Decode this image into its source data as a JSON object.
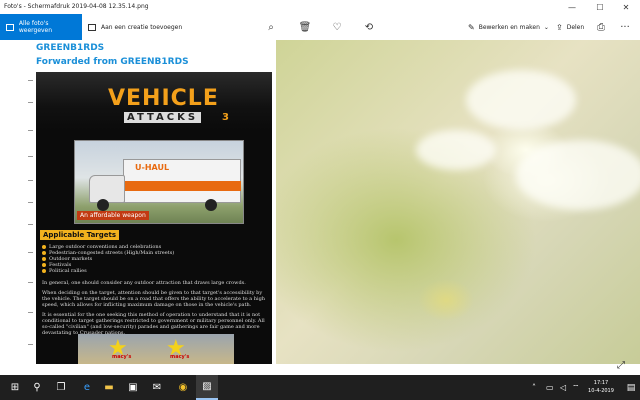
{
  "window": {
    "title": "Foto's - Schermafdruk 2019-04-08 12.35.14.png",
    "minimize": "—",
    "maximize": "☐",
    "close": "✕"
  },
  "toolbar": {
    "all_photos_label": "Alle foto's weergeven",
    "add_creation_label": "Aan een creatie toevoegen",
    "zoom_icon": "⌕",
    "delete_icon": "🗑",
    "favorite_icon": "♡",
    "rotate_icon": "⟲",
    "edit_create_label": "Bewerken en maken",
    "share_label": "Delen",
    "print_icon": "⎙",
    "more_icon": "···"
  },
  "document": {
    "heading_1": "GREENB1RDS",
    "heading_2": "Forwarded from GREENB1RDS",
    "magazine": {
      "title_main": "VEHICLE",
      "title_sub": "ATTACKS",
      "issue": "3",
      "truck_logo": "U-HAUL",
      "caption": "An affordable weapon",
      "targets_heading": "Applicable Targets",
      "targets": [
        "Large outdoor conventions and celebrations",
        "Pedestrian-congested streets (High/Main streets)",
        "Outdoor markets",
        "Festivals",
        "Political rallies"
      ],
      "para1": "In general, one should consider any outdoor attraction that draws large crowds.",
      "para2": "When deciding on the target, attention should be given to that target's accessibility by the vehicle. The target should be on a road that offers the ability to accelerate to a high speed, which allows for inflicting maximum damage on those in the vehicle's path.",
      "para3": "It is essential for the one seeking this method of operation to understand that it is not conditional to target gatherings restricted to government or military personnel only. All so-called \"civilian\" (and low-security) parades and gatherings are fair game and more devastating to Crusader nations.",
      "balloon_label": "macy's"
    }
  },
  "taskbar": {
    "start_icon": "windows-icon",
    "search_icon": "search-icon",
    "task_view_icon": "task-view-icon",
    "edge_icon": "edge-icon",
    "explorer_icon": "folder-icon",
    "store_icon": "store-icon",
    "mail_icon": "mail-icon",
    "chrome_icon": "chrome-icon",
    "photos_icon": "photos-icon",
    "time": "17:17",
    "date": "10-4-2019"
  }
}
